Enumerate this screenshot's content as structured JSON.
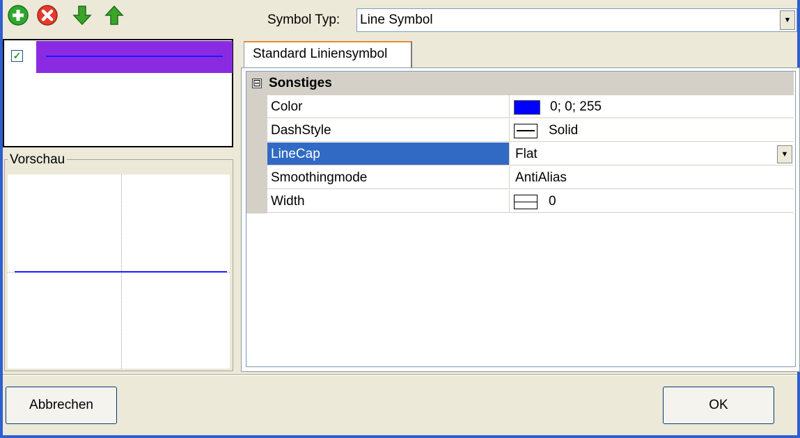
{
  "toolbar": {
    "buttons": [
      {
        "icon": "add-icon",
        "color": "#2ea82e"
      },
      {
        "icon": "delete-icon",
        "color": "#e33b2e"
      },
      {
        "icon": "arrow-down-icon",
        "color": "#3aa52a"
      },
      {
        "icon": "arrow-up-icon",
        "color": "#3aa52a"
      }
    ]
  },
  "symbol_list": {
    "items": [
      {
        "checked": true,
        "swatch_color": "#8a2be2",
        "line_color": "#1a1aff"
      }
    ]
  },
  "preview": {
    "title": "Vorschau",
    "line_color": "#1a1aff"
  },
  "symbol_type": {
    "label": "Symbol Typ:",
    "value": "Line Symbol"
  },
  "tab": {
    "label": "Standard Liniensymbol"
  },
  "property_grid": {
    "category": {
      "toggle": "⊟",
      "label": "Sonstiges"
    },
    "rows": [
      {
        "name": "Color",
        "value": "0; 0; 255",
        "swatch": "#0000ff"
      },
      {
        "name": "DashStyle",
        "value": "Solid"
      },
      {
        "name": "LineCap",
        "value": "Flat",
        "selected": true
      },
      {
        "name": "Smoothingmode",
        "value": "AntiAlias"
      },
      {
        "name": "Width",
        "value": "0"
      }
    ]
  },
  "buttons": {
    "cancel": "Abbrechen",
    "ok": "OK"
  }
}
